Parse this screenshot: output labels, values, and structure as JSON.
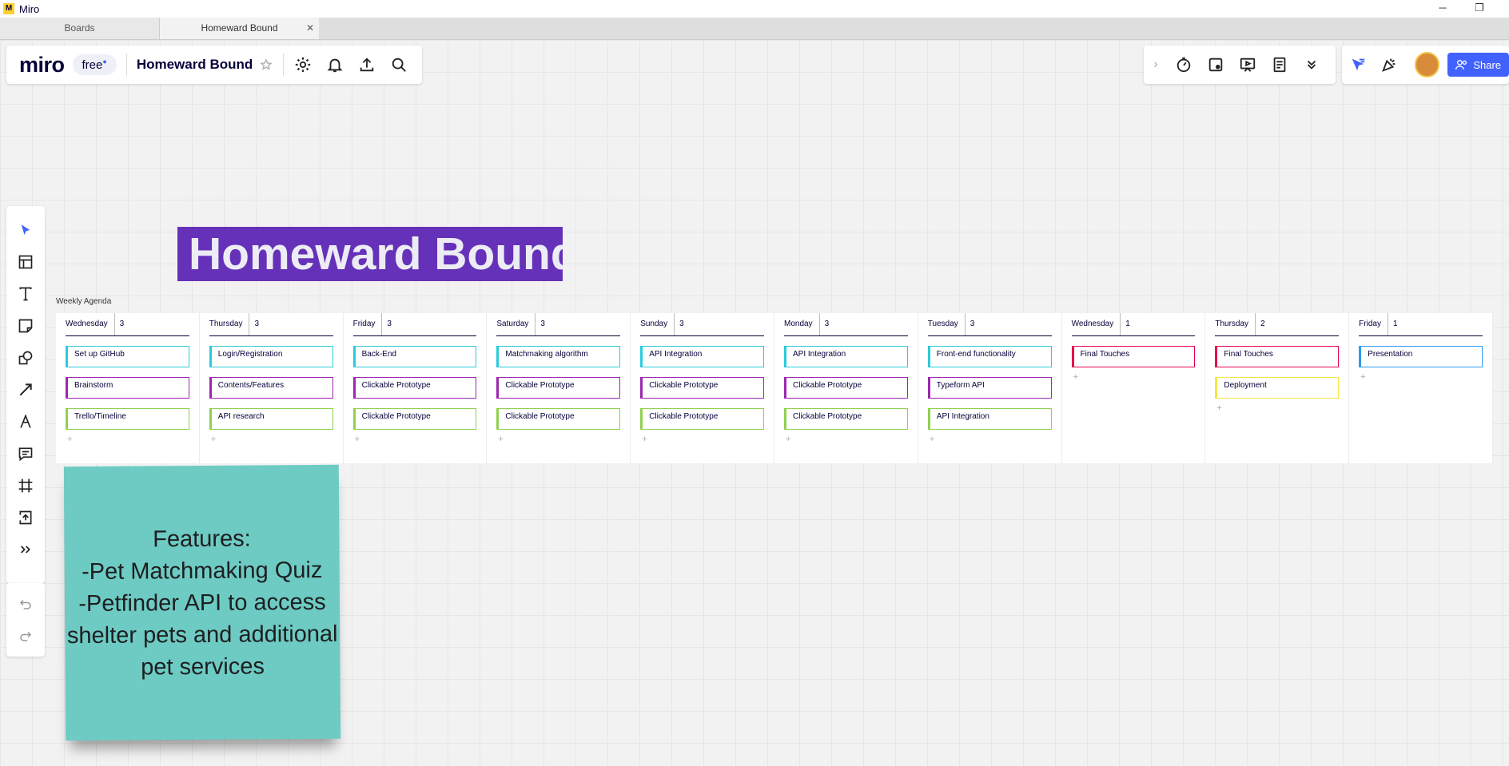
{
  "window": {
    "app_title": "Miro",
    "app_logo": "M",
    "minimize": "─",
    "restore": "❐"
  },
  "tabs": [
    {
      "label": "Boards",
      "active": false
    },
    {
      "label": "Homeward Bound",
      "active": true,
      "close": "✕"
    }
  ],
  "header": {
    "logo": "miro",
    "plan": "free",
    "board_name": "Homeward Bound"
  },
  "toolbar_right": {
    "share_label": "Share"
  },
  "board": {
    "title": "Homeward Bound",
    "agenda_label": "Weekly Agenda",
    "columns": [
      {
        "day": "Wednesday",
        "count": "3",
        "cards": [
          {
            "text": "Set up GitHub",
            "color": "#2ccadc"
          },
          {
            "text": "Brainstorm",
            "color": "#9c27b0"
          },
          {
            "text": "Trello/Timeline",
            "color": "#8fd14f"
          }
        ]
      },
      {
        "day": "Thursday",
        "count": "3",
        "cards": [
          {
            "text": "Login/Registration",
            "color": "#2ccadc"
          },
          {
            "text": "Contents/Features",
            "color": "#9c27b0"
          },
          {
            "text": "API research",
            "color": "#8fd14f"
          }
        ]
      },
      {
        "day": "Friday",
        "count": "3",
        "cards": [
          {
            "text": "Back-End",
            "color": "#2ccadc"
          },
          {
            "text": "Clickable Prototype",
            "color": "#9c27b0"
          },
          {
            "text": "Clickable Prototype",
            "color": "#8fd14f"
          }
        ]
      },
      {
        "day": "Saturday",
        "count": "3",
        "cards": [
          {
            "text": "Matchmaking algorithm",
            "color": "#2ccadc"
          },
          {
            "text": "Clickable Prototype",
            "color": "#9c27b0"
          },
          {
            "text": "Clickable Prototype",
            "color": "#8fd14f"
          }
        ]
      },
      {
        "day": "Sunday",
        "count": "3",
        "cards": [
          {
            "text": "API Integration",
            "color": "#2ccadc"
          },
          {
            "text": "Clickable Prototype",
            "color": "#9c27b0"
          },
          {
            "text": "Clickable Prototype",
            "color": "#8fd14f"
          }
        ]
      },
      {
        "day": "Monday",
        "count": "3",
        "cards": [
          {
            "text": "API Integration",
            "color": "#2ccadc"
          },
          {
            "text": "Clickable Prototype",
            "color": "#9c27b0"
          },
          {
            "text": "Clickable Prototype",
            "color": "#8fd14f"
          }
        ]
      },
      {
        "day": "Tuesday",
        "count": "3",
        "cards": [
          {
            "text": "Front-end functionality",
            "color": "#2ccadc"
          },
          {
            "text": "Typeform API",
            "color": "#9c27b0"
          },
          {
            "text": "API Integration",
            "color": "#8fd14f"
          }
        ]
      },
      {
        "day": "Wednesday",
        "count": "1",
        "cards": [
          {
            "text": "Final Touches",
            "color": "#e6004c"
          }
        ]
      },
      {
        "day": "Thursday",
        "count": "2",
        "cards": [
          {
            "text": "Final Touches",
            "color": "#e6004c"
          },
          {
            "text": "Deployment",
            "color": "#f5e642"
          }
        ]
      },
      {
        "day": "Friday",
        "count": "1",
        "cards": [
          {
            "text": "Presentation",
            "color": "#2d9bf0"
          }
        ]
      }
    ],
    "add_symbol": "+",
    "sticky_note": {
      "text": "Features:\n-Pet Matchmaking Quiz\n-Petfinder API to access shelter pets and additional pet services",
      "color": "#6dcbc4"
    }
  },
  "colors": {
    "accent": "#4262ff",
    "title_bg": "#6631b9"
  },
  "icons": {
    "header": [
      "star-icon",
      "settings-gear-icon",
      "bell-icon",
      "upload-icon",
      "search-icon"
    ],
    "right": [
      "chevron-right-icon",
      "timer-icon",
      "voting-icon",
      "presentation-icon",
      "notes-icon",
      "chevrons-down-icon",
      "cursor-filter-icon",
      "celebrate-icon",
      "share-people-icon"
    ],
    "left_toolbar": [
      "select-arrow-icon",
      "templates-icon",
      "text-icon",
      "sticky-note-icon",
      "shapes-icon",
      "connector-arrow-icon",
      "pen-icon",
      "comment-icon",
      "frame-icon",
      "upload-icon",
      "more-tools-icon",
      "undo-icon",
      "redo-icon"
    ]
  }
}
